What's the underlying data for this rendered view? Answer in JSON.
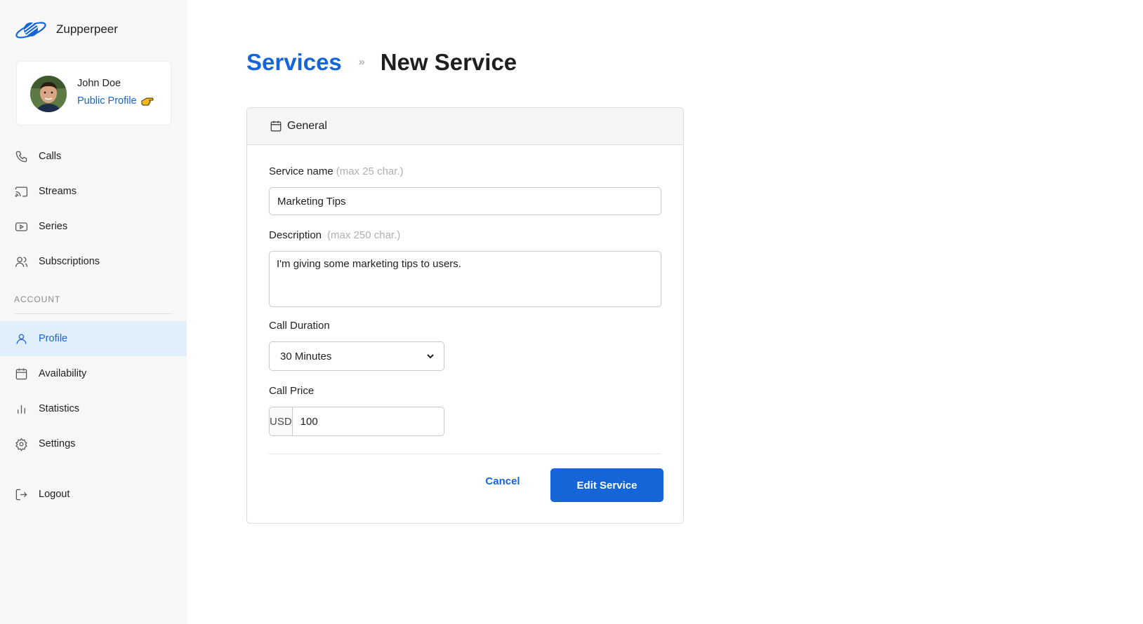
{
  "app": {
    "name": "Zupperpeer"
  },
  "user": {
    "name": "John Doe",
    "public_profile_label": "Public Profile"
  },
  "nav": {
    "main": [
      {
        "label": "Calls",
        "icon": "phone-icon"
      },
      {
        "label": "Streams",
        "icon": "cast-icon"
      },
      {
        "label": "Series",
        "icon": "play-square-icon"
      },
      {
        "label": "Subscriptions",
        "icon": "users-icon"
      }
    ],
    "account_section_label": "ACCOUNT",
    "account": [
      {
        "label": "Profile",
        "icon": "user-icon",
        "active": true
      },
      {
        "label": "Availability",
        "icon": "calendar-icon"
      },
      {
        "label": "Statistics",
        "icon": "bar-chart-icon"
      },
      {
        "label": "Settings",
        "icon": "gear-icon"
      }
    ],
    "logout_label": "Logout"
  },
  "breadcrumb": {
    "parent": "Services",
    "current": "New Service"
  },
  "form": {
    "section_title": "General",
    "service_name": {
      "label": "Service name",
      "hint": "(max 25 char.)",
      "value": "Marketing Tips"
    },
    "description": {
      "label": "Description",
      "hint": "(max 250 char.)",
      "value": "I'm giving some marketing tips to users."
    },
    "call_duration": {
      "label": "Call Duration",
      "selected": "30 Minutes"
    },
    "call_price": {
      "label": "Call Price",
      "currency": "USD",
      "value": "100"
    },
    "cancel_label": "Cancel",
    "submit_label": "Edit Service"
  },
  "colors": {
    "accent": "#1565d8",
    "active_bg": "#e1effd",
    "sidebar_bg": "#f7f7f7"
  }
}
